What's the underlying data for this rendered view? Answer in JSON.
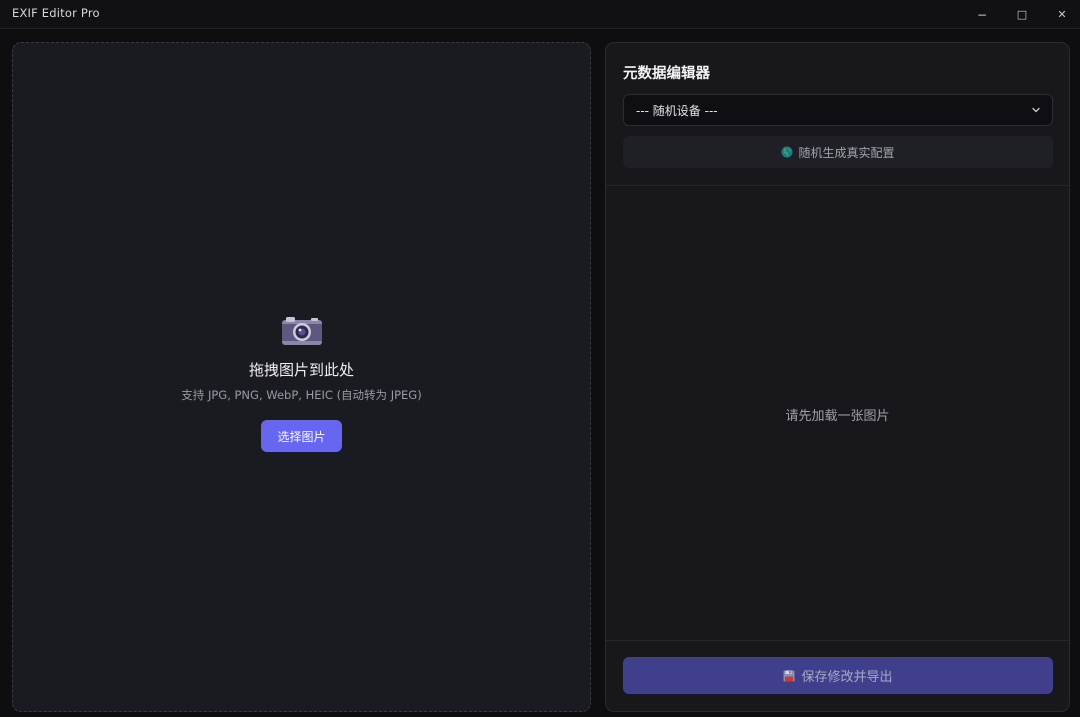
{
  "window": {
    "title": "EXIF Editor Pro",
    "minimize_glyph": "−",
    "maximize_glyph": "□",
    "close_glyph": "✕"
  },
  "drop_zone": {
    "icon": "camera-icon",
    "title": "拖拽图片到此处",
    "subtitle": "支持 JPG, PNG, WebP, HEIC (自动转为 JPEG)",
    "button_label": "选择图片"
  },
  "editor": {
    "title": "元数据编辑器",
    "device_select": {
      "selected": "--- 随机设备 ---"
    },
    "random_button": {
      "icon": "globe-icon",
      "label": "随机生成真实配置"
    },
    "empty_message": "请先加载一张图片",
    "save_button": {
      "icon": "floppy-disk-icon",
      "label": "保存修改并导出"
    }
  },
  "colors": {
    "accent": "#6666f0",
    "accent_disabled": "#3f3f8c",
    "panel_bg": "#1a1a21",
    "app_bg": "#0e0e11"
  }
}
